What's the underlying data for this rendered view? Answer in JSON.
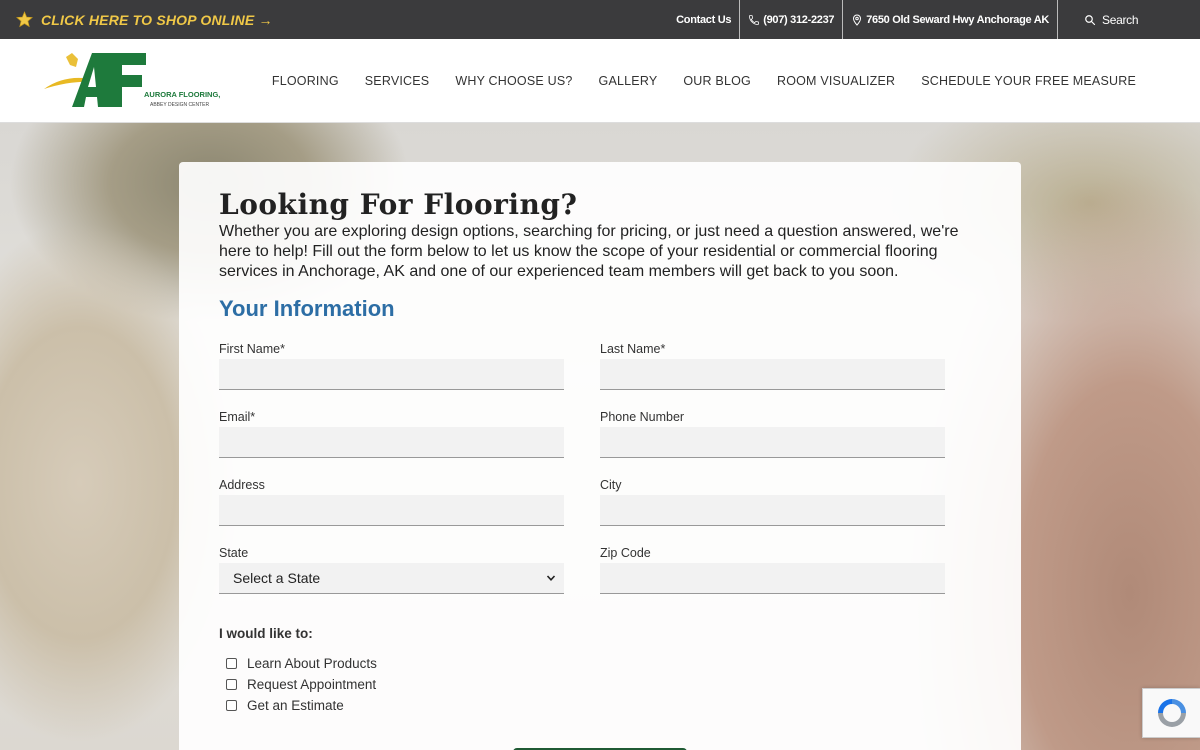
{
  "topbar": {
    "shop_label": "CLICK HERE TO SHOP ONLINE →",
    "contact_label": "Contact Us",
    "phone": "(907) 312-2237",
    "address": "7650 Old Seward Hwy Anchorage AK",
    "search_label": "Search"
  },
  "logo": {
    "letters": "AF",
    "company": "AURORA FLOORING, LLC",
    "tagline": "ABBEY DESIGN CENTER"
  },
  "nav": {
    "items": [
      "FLOORING",
      "SERVICES",
      "WHY CHOOSE US?",
      "GALLERY",
      "OUR BLOG",
      "ROOM VISUALIZER",
      "SCHEDULE YOUR FREE MEASURE"
    ]
  },
  "form": {
    "title": "Looking For Flooring?",
    "intro": "Whether you are exploring design options, searching for pricing, or just need a question answered, we're here to help! Fill out the form below to let us know the scope of your residential or commercial flooring services in Anchorage, AK and one of our experienced team members will get back to you soon.",
    "section_title": "Your Information",
    "first_name_label": "First Name*",
    "last_name_label": "Last Name*",
    "email_label": "Email*",
    "phone_label": "Phone Number",
    "address_label": "Address",
    "city_label": "City",
    "state_label": "State",
    "state_value": "Select a State",
    "zip_label": "Zip Code",
    "like_label": "I would like to:",
    "options": [
      "Learn About Products",
      "Request Appointment",
      "Get an Estimate"
    ]
  },
  "colors": {
    "topbar_bg": "#3b3b3d",
    "shop_text": "#f0c847",
    "section_title": "#2d6ea5",
    "logo_green": "#1e7a3c",
    "logo_gold": "#e8b923",
    "submit_green": "#1f5a34"
  },
  "icons": [
    "star-icon",
    "phone-icon",
    "map-pin-icon",
    "search-icon",
    "chevron-down-icon",
    "recaptcha-icon"
  ]
}
